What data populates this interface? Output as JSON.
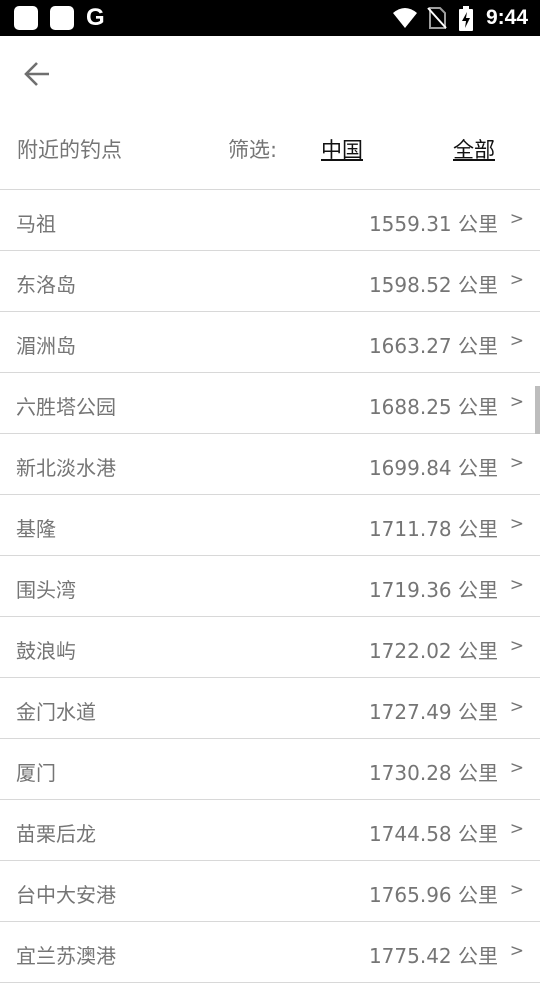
{
  "status_bar": {
    "time": "9:44",
    "icons": [
      "notification-square-icon",
      "notification-square-icon",
      "google-g-icon",
      "wifi-icon",
      "no-sim-icon",
      "battery-charging-icon"
    ],
    "g_glyph": "G"
  },
  "header": {
    "back_icon": "arrow-left-icon"
  },
  "filter": {
    "title": "附近的钓点",
    "label": "筛选:",
    "options": [
      {
        "label": "中国"
      },
      {
        "label": "全部"
      }
    ]
  },
  "spots": [
    {
      "name": "马祖",
      "distance": "1559.31 公里",
      "arrow": ">"
    },
    {
      "name": "东洛岛",
      "distance": "1598.52 公里",
      "arrow": ">"
    },
    {
      "name": "湄洲岛",
      "distance": "1663.27 公里",
      "arrow": ">"
    },
    {
      "name": "六胜塔公园",
      "distance": "1688.25 公里",
      "arrow": ">"
    },
    {
      "name": "新北淡水港",
      "distance": "1699.84 公里",
      "arrow": ">"
    },
    {
      "name": "基隆",
      "distance": "1711.78 公里",
      "arrow": ">"
    },
    {
      "name": "围头湾",
      "distance": "1719.36 公里",
      "arrow": ">"
    },
    {
      "name": "鼓浪屿",
      "distance": "1722.02 公里",
      "arrow": ">"
    },
    {
      "name": "金门水道",
      "distance": "1727.49 公里",
      "arrow": ">"
    },
    {
      "name": "厦门",
      "distance": "1730.28 公里",
      "arrow": ">"
    },
    {
      "name": "苗栗后龙",
      "distance": "1744.58 公里",
      "arrow": ">"
    },
    {
      "name": "台中大安港",
      "distance": "1765.96 公里",
      "arrow": ">"
    },
    {
      "name": "宜兰苏澳港",
      "distance": "1775.42 公里",
      "arrow": ">"
    }
  ],
  "colors": {
    "status_bar_bg": "#000000",
    "text_secondary": "#757575",
    "text_primary": "#111111",
    "divider": "#d8d8d8"
  }
}
